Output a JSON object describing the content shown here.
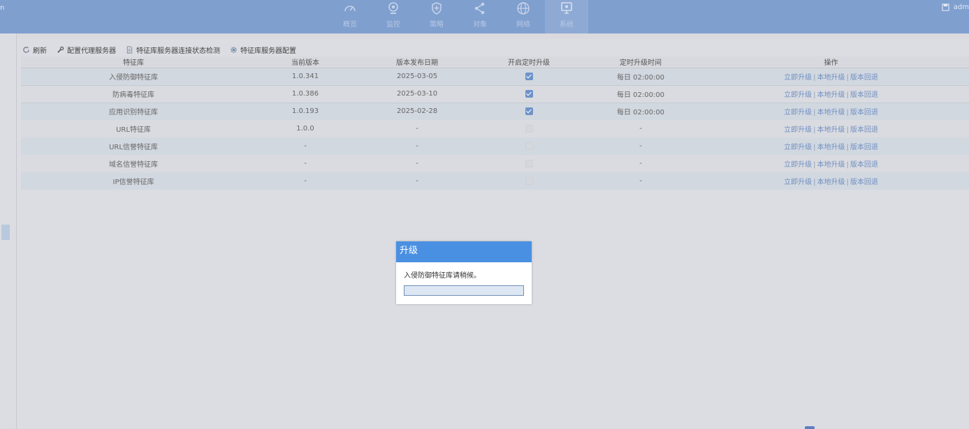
{
  "header": {
    "left_fragment": "n",
    "user_fragment": "adm",
    "nav": [
      {
        "label": "概览",
        "icon": "gauge-icon",
        "active": false
      },
      {
        "label": "监控",
        "icon": "webcam-icon",
        "active": false
      },
      {
        "label": "策略",
        "icon": "shield-icon",
        "active": false
      },
      {
        "label": "对象",
        "icon": "share-icon",
        "active": false
      },
      {
        "label": "网络",
        "icon": "globe-icon",
        "active": false
      },
      {
        "label": "系统",
        "icon": "monitor-icon",
        "active": true
      }
    ]
  },
  "toolbar": {
    "refresh": "刷新",
    "proxy": "配置代理服务器",
    "check": "特征库服务器连接状态检测",
    "config": "特征库服务器配置"
  },
  "table": {
    "columns": [
      "特征库",
      "当前版本",
      "版本发布日期",
      "开启定时升级",
      "定时升级时间",
      "操作"
    ],
    "rows": [
      {
        "name": "入侵防御特征库",
        "version": "1.0.341",
        "date": "2025-03-05",
        "scheduled": true,
        "time": "每日 02:00:00"
      },
      {
        "name": "防病毒特征库",
        "version": "1.0.386",
        "date": "2025-03-10",
        "scheduled": true,
        "time": "每日 02:00:00"
      },
      {
        "name": "应用识别特征库",
        "version": "1.0.193",
        "date": "2025-02-28",
        "scheduled": true,
        "time": "每日 02:00:00"
      },
      {
        "name": "URL特征库",
        "version": "1.0.0",
        "date": "-",
        "scheduled": false,
        "time": "-"
      },
      {
        "name": "URL信誉特征库",
        "version": "-",
        "date": "-",
        "scheduled": false,
        "time": "-"
      },
      {
        "name": "域名信誉特征库",
        "version": "-",
        "date": "-",
        "scheduled": false,
        "time": "-"
      },
      {
        "name": "IP信誉特征库",
        "version": "-",
        "date": "-",
        "scheduled": false,
        "time": "-"
      }
    ],
    "ops": {
      "upgrade_now": "立即升级",
      "local_upgrade": "本地升级",
      "rollback": "版本回退",
      "sep": "|"
    }
  },
  "dialog": {
    "title": "升级",
    "message": "入侵防御特征库请稍候。",
    "progress": 0
  },
  "colors": {
    "accent": "#4a90e2",
    "topbar": "#7f9fcf",
    "link": "#6f8fc2"
  }
}
